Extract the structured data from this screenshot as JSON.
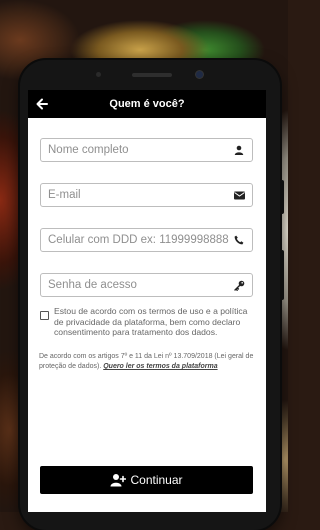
{
  "header": {
    "title": "Quem é você?"
  },
  "form": {
    "name_placeholder": "Nome completo",
    "email_placeholder": "E-mail",
    "phone_placeholder": "Celular com DDD ex: 11999998888",
    "password_placeholder": "Senha de acesso"
  },
  "consent": {
    "text": "Estou de acordo com os termos de uso e a política de privacidade da plataforma, bem como declaro consentimento para tratamento dos dados."
  },
  "law": {
    "text": "De acordo com os artigos 7º e 11 da Lei nº 13.709/2018 (Lei geral de proteção de dados). ",
    "link_label": "Quero ler os termos da plataforma"
  },
  "actions": {
    "continue_label": "Continuar"
  }
}
